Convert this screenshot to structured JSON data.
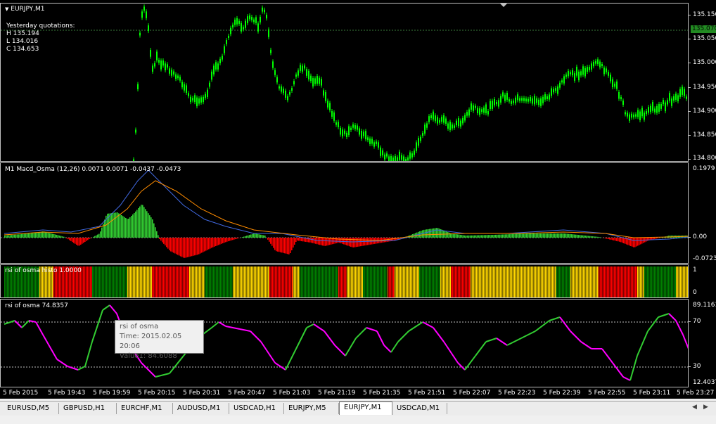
{
  "price_pane": {
    "title": "EURJPY,M1",
    "quotes_header": "Yesterday quotations:",
    "high": "H 135.194",
    "low": "L 134.016",
    "close": "C 134.653",
    "current_price": "135.070",
    "scale": [
      "135.150",
      "135.050",
      "135.000",
      "134.950",
      "134.900",
      "134.850",
      "134.800"
    ]
  },
  "macd_pane": {
    "title": "M1  Macd_Osma (12,26) 0.0071 0.0071 -0.0437 -0.0473",
    "scale": [
      "0.1979",
      "0.00",
      "-0.0723"
    ]
  },
  "histo_pane": {
    "title": "rsi of osma histo 1.0000",
    "scale": [
      "1",
      "0"
    ]
  },
  "rsi_pane": {
    "title": "rsi of osma 74.8357",
    "scale": [
      "89.1161",
      "70",
      "30",
      "12.4037"
    ]
  },
  "tooltip": {
    "name": "rsi of osma",
    "time": "Time: 2015.02.05 20:06",
    "value": "Value1: 84.6088"
  },
  "time_axis": [
    "5 Feb 2015",
    "5 Feb 19:43",
    "5 Feb 19:59",
    "5 Feb 20:15",
    "5 Feb 20:31",
    "5 Feb 20:47",
    "5 Feb 21:03",
    "5 Feb 21:19",
    "5 Feb 21:35",
    "5 Feb 21:51",
    "5 Feb 22:07",
    "5 Feb 22:23",
    "5 Feb 22:39",
    "5 Feb 22:55",
    "5 Feb 23:11",
    "5 Feb 23:27"
  ],
  "tabs": [
    "EURUSD,M5",
    "GBPUSD,H1",
    "EURCHF,M1",
    "AUDUSD,M1",
    "USDCAD,H1",
    "EURJPY,M5",
    "EURJPY,M1",
    "USDCAD,M1"
  ],
  "active_tab": 6,
  "colors": {
    "bull": "#00ff00",
    "macd_pos": "#32cd32",
    "macd_neg": "#ff0000",
    "histo_green": "#008000",
    "histo_red": "#ff0000",
    "histo_yellow": "#ffd700",
    "rsi_up": "#32cd32",
    "rsi_down": "#ff00ff",
    "signal": "#ff8c00",
    "macd_line": "#4169e1"
  }
}
